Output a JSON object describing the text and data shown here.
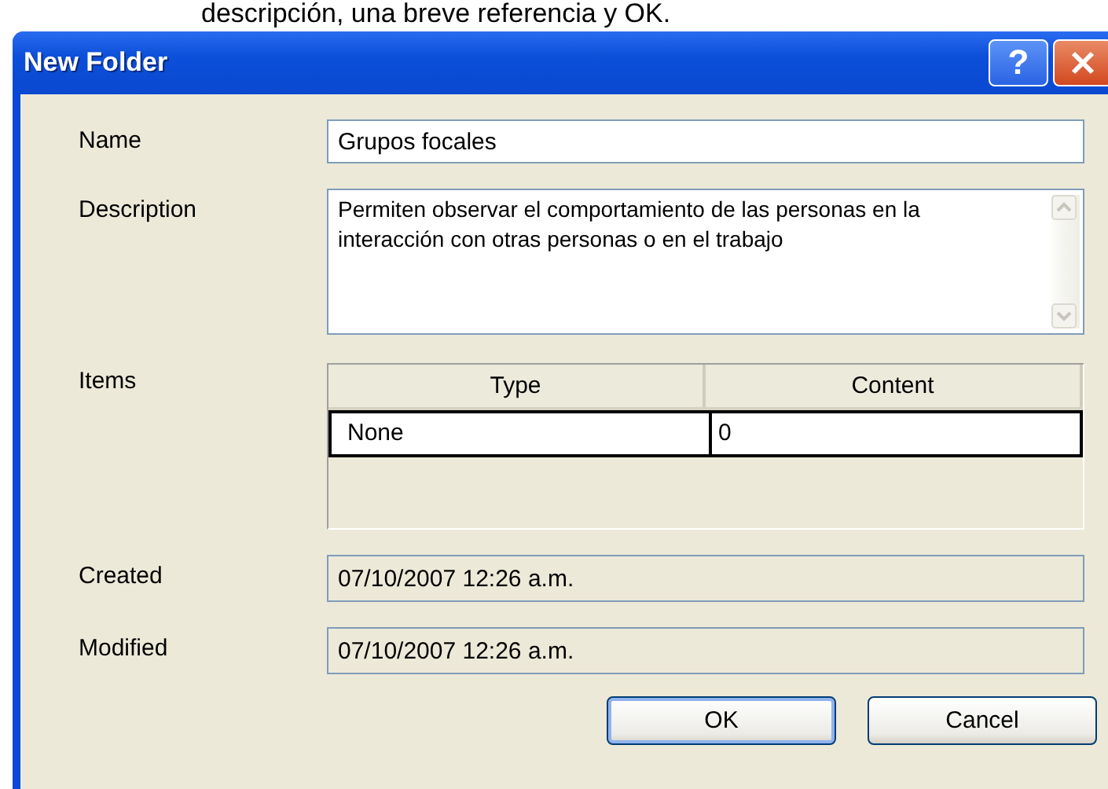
{
  "caption": "descripción, una breve referencia y OK.",
  "window": {
    "title": "New Folder",
    "help_button": "?"
  },
  "name": {
    "label": "Name",
    "value": "Grupos focales"
  },
  "description": {
    "label": "Description",
    "value": "Permiten observar el comportamiento de las personas en la interacción con otras personas o en el trabajo"
  },
  "items": {
    "label": "Items",
    "columns": [
      "Type",
      "Content"
    ],
    "rows": [
      [
        "None",
        "0"
      ]
    ]
  },
  "created": {
    "label": "Created",
    "value": "07/10/2007 12:26 a.m."
  },
  "modified": {
    "label": "Modified",
    "value": "07/10/2007 12:26 a.m."
  },
  "buttons": [
    {
      "label": "OK",
      "default": true
    },
    {
      "label": "Cancel",
      "default": false
    }
  ]
}
